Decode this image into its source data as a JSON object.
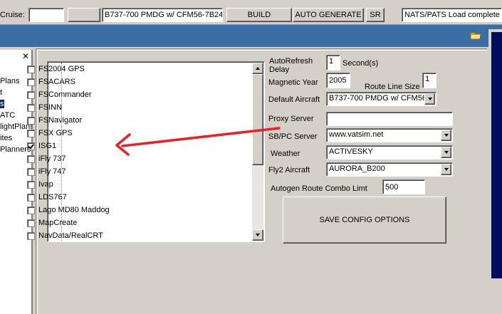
{
  "toolbar": {
    "cruise_label": "Cruise:",
    "cruise_value": "",
    "aircraft_value": "B737-700 PMDG w/ CFM56-7B24",
    "build_label": "BUILD",
    "auto_generate_label": "AUTO GENERATE",
    "sr_label": "SR",
    "status_text": "NATS/PATS Load complete"
  },
  "sidebar": {
    "close_glyph": "✕",
    "items": [
      "Plans",
      "t",
      "s",
      "ATC",
      "lightPlans",
      "ites",
      "Planners"
    ],
    "selected_index": 2
  },
  "plugins": {
    "items": [
      {
        "label": "FS2004 GPS",
        "checked": false
      },
      {
        "label": "FSACARS",
        "checked": false
      },
      {
        "label": "FSCommander",
        "checked": false
      },
      {
        "label": "FSINN",
        "checked": false
      },
      {
        "label": "FSNavigator",
        "checked": false
      },
      {
        "label": "FSX GPS",
        "checked": false
      },
      {
        "label": "ISG1",
        "checked": true
      },
      {
        "label": "iFly 737",
        "checked": false
      },
      {
        "label": "iFly 747",
        "checked": false
      },
      {
        "label": "Ivap",
        "checked": false
      },
      {
        "label": "LDS767",
        "checked": false
      },
      {
        "label": "Lago MD80 Maddog",
        "checked": false
      },
      {
        "label": "MapCreate",
        "checked": false
      },
      {
        "label": "NavData/RealCRT",
        "checked": false
      }
    ]
  },
  "options": {
    "autorefresh_label": "AutoRefresh Delay",
    "autorefresh_value": "1",
    "autorefresh_unit": "Second(s)",
    "magnetic_year_label": "Magnetic Year",
    "magnetic_year_value": "2005",
    "route_line_size_label": "Route Line Size",
    "route_line_size_value": "1",
    "default_aircraft_label": "Default Aircraft",
    "default_aircraft_value": "B737-700 PMDG w/ CFM56",
    "proxy_server_label": "Proxy Server",
    "proxy_server_value": "",
    "sbpc_server_label": "SB/PC Server",
    "sbpc_server_value": "www.vatsim.net",
    "weather_label": "Weather",
    "weather_value": "ACTIVESKY",
    "fly2_aircraft_label": "Fly2 Aircraft",
    "fly2_aircraft_value": "AURORA_B200",
    "autogen_label": "Autogen Route Combo Limt",
    "autogen_value": "500",
    "save_label": "SAVE CONFIG OPTIONS"
  },
  "colors": {
    "arrow": "#e8202a",
    "header_band": "#3a6ea5",
    "selection": "#0a246a"
  },
  "icons": {
    "folder": "folder-icon",
    "close": "close-icon"
  }
}
